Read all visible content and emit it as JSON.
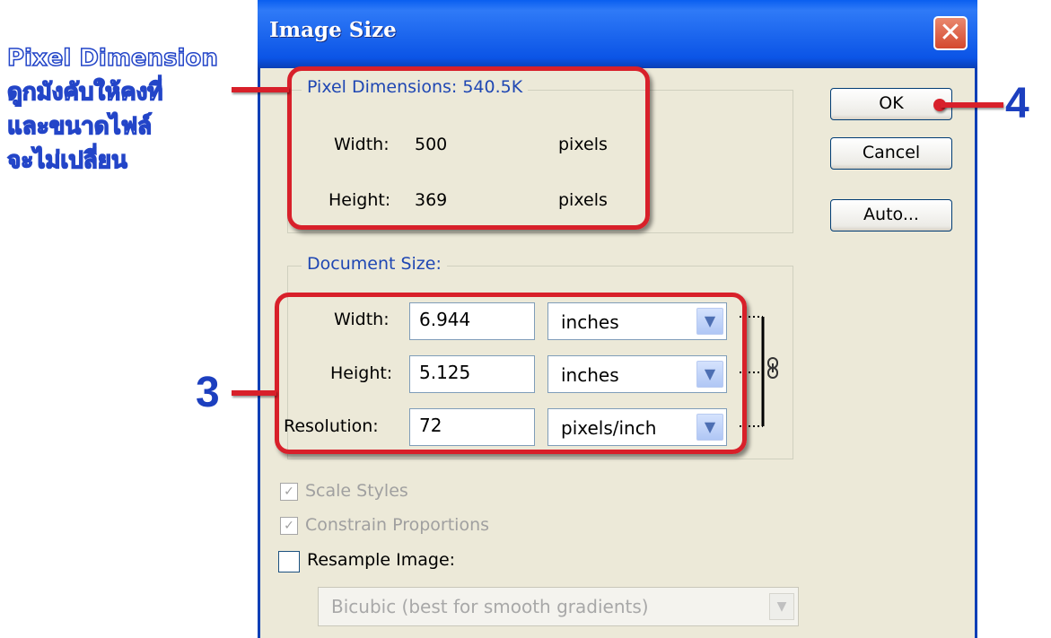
{
  "dialog": {
    "title": "Image Size",
    "close_label": "✕"
  },
  "pixel_dimensions": {
    "legend": "Pixel Dimensions:  540.5K",
    "width_label": "Width:",
    "width_value": "500",
    "width_unit": "pixels",
    "height_label": "Height:",
    "height_value": "369",
    "height_unit": "pixels"
  },
  "document_size": {
    "legend": "Document Size:",
    "width_label": "Width:",
    "width_value": "6.944",
    "width_unit": "inches",
    "height_label": "Height:",
    "height_value": "5.125",
    "height_unit": "inches",
    "resolution_label": "Resolution:",
    "resolution_value": "72",
    "resolution_unit": "pixels/inch"
  },
  "buttons": {
    "ok": "OK",
    "cancel": "Cancel",
    "auto": "Auto..."
  },
  "options": {
    "scale_styles": "Scale Styles",
    "constrain_proportions": "Constrain Proportions",
    "resample_image": "Resample Image:",
    "resample_method": "Bicubic (best for smooth gradients)"
  },
  "annotations": {
    "note_lines": [
      "Pixel Dimension",
      "ดูกมังคับให้คงที่",
      "และขนาดไฟล์",
      "จะไม่เปลี่ยน"
    ],
    "step3": "3",
    "step4": "4"
  },
  "colors": {
    "annotation_red": "#d8202a",
    "annotation_blue": "#1c3fbf",
    "xp_title_blue": "#0a5ff0"
  }
}
